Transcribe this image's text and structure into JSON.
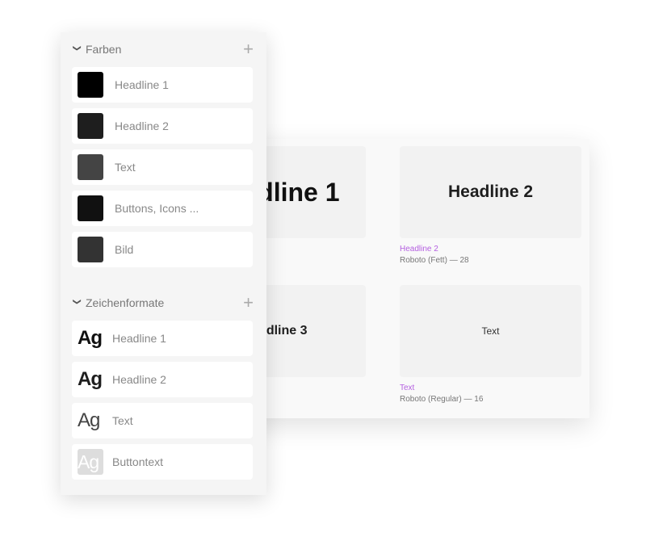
{
  "canvas": {
    "cards": [
      {
        "preview": "Headline 1"
      },
      {
        "preview": "Headline 2",
        "name": "Headline 2",
        "desc": "Roboto (Fett) — 28"
      },
      {
        "preview": "Headline 3"
      },
      {
        "preview": "Text",
        "name": "Text",
        "desc": "Roboto (Regular) — 16"
      }
    ]
  },
  "sidebar": {
    "colors": {
      "title": "Farben",
      "items": [
        {
          "label": "Headline 1",
          "color": "#000000"
        },
        {
          "label": "Headline 2",
          "color": "#1e1e1e"
        },
        {
          "label": "Text",
          "color": "#444444"
        },
        {
          "label": "Buttons, Icons ...",
          "color": "#111111"
        },
        {
          "label": "Bild",
          "color": "#333333"
        }
      ]
    },
    "formats": {
      "title": "Zeichenformate",
      "sample": "Ag",
      "items": [
        {
          "label": "Headline 1"
        },
        {
          "label": "Headline 2"
        },
        {
          "label": "Text"
        },
        {
          "label": "Buttontext"
        }
      ]
    }
  },
  "accent": "#b45fe0"
}
